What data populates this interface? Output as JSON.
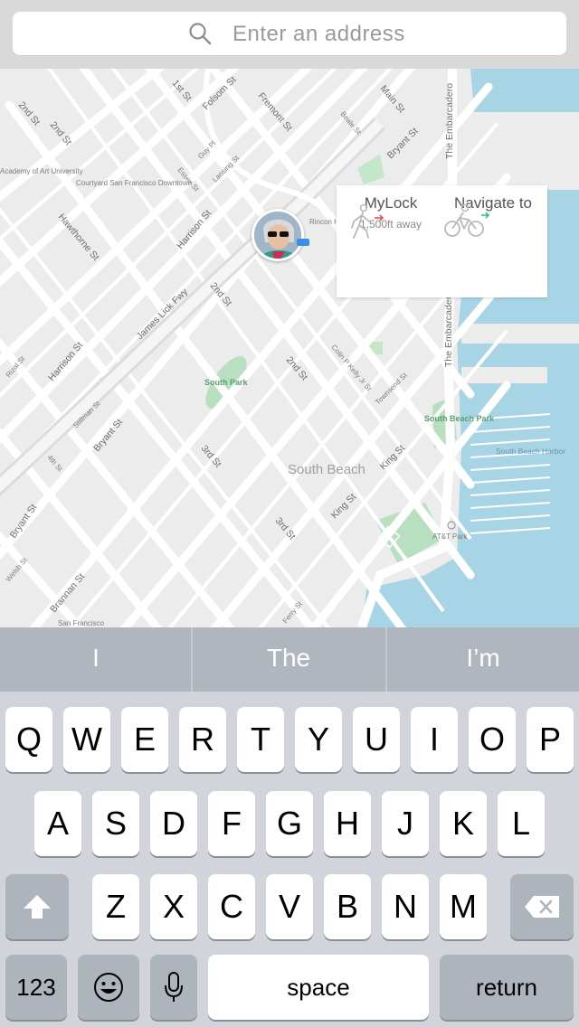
{
  "search": {
    "placeholder": "Enter an address",
    "icon": "search-icon"
  },
  "map": {
    "streets": [
      "2nd St",
      "2nd St",
      "1st St",
      "Folsom St",
      "Fremont St",
      "Main St",
      "Beale St",
      "Bryant St",
      "The Embarcadero",
      "The Embarcadero",
      "Guy Pl",
      "Lansing St",
      "Essex St",
      "Hawthorne St",
      "Harrison St",
      "James Lick Fwy",
      "2nd St",
      "Rincon Hill",
      "Harrison St",
      "Rizal St",
      "Stillman St",
      "Bryant St",
      "4th St",
      "3rd St",
      "2nd St",
      "Colin P Kelly Jr St",
      "Townsend St",
      "King St",
      "King St",
      "Bryant St",
      "Welsh St",
      "Brannan St",
      "3rd St",
      "Ferry St",
      "San Francisco"
    ],
    "pois": [
      "Academy of Art University",
      "Courtyard San Francisco Downtown",
      "AT&T Park"
    ],
    "areas": [
      "South Park",
      "South Beach Park",
      "South Beach"
    ],
    "water_labels": [
      "South Beach Harbor"
    ]
  },
  "popup": {
    "option1": {
      "title": "MyLock",
      "subtitle": "1,500ft away",
      "icon": "walking-person-icon"
    },
    "option2": {
      "title": "Navigate to",
      "icon": "bicycle-icon"
    }
  },
  "suggestions": [
    "I",
    "The",
    "I’m"
  ],
  "keyboard": {
    "row1": [
      "Q",
      "W",
      "E",
      "R",
      "T",
      "Y",
      "U",
      "I",
      "O",
      "P"
    ],
    "row2": [
      "A",
      "S",
      "D",
      "F",
      "G",
      "H",
      "J",
      "K",
      "L"
    ],
    "row3": [
      "Z",
      "X",
      "C",
      "V",
      "B",
      "N",
      "M"
    ],
    "numbers_label": "123",
    "space_label": "space",
    "return_label": "return"
  }
}
